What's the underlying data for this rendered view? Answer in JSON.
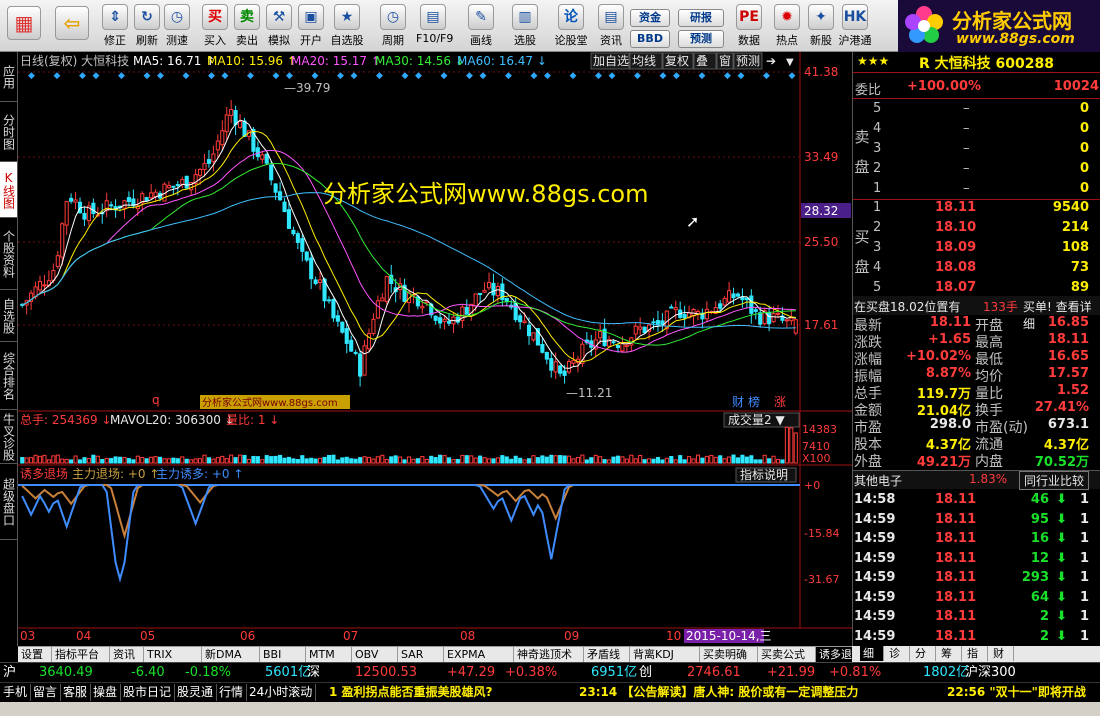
{
  "toolbar": {
    "items": [
      {
        "label": "",
        "icon": "windows-logo-icon"
      },
      {
        "label": "",
        "icon": "back-arrow-icon"
      },
      {
        "label": "修正",
        "icon": "up-down-icon"
      },
      {
        "label": "刷新",
        "icon": "refresh-icon"
      },
      {
        "label": "测速",
        "icon": "clock-icon"
      },
      {
        "label": "买入",
        "icon": "buy-icon",
        "glyph": "买"
      },
      {
        "label": "卖出",
        "icon": "sell-icon",
        "glyph": "卖"
      },
      {
        "label": "模拟",
        "icon": "hammer-icon"
      },
      {
        "label": "开户",
        "icon": "lock-icon"
      },
      {
        "label": "自选股",
        "icon": "star-folder-icon"
      },
      {
        "label": "周期",
        "icon": "period-icon"
      },
      {
        "label": "F10/F9",
        "icon": "f10-icon"
      },
      {
        "label": "画线",
        "icon": "pencil-icon"
      },
      {
        "label": "选股",
        "icon": "screen-select-icon"
      },
      {
        "label": "论股堂",
        "icon": "forum-icon",
        "glyph": "论"
      },
      {
        "label": "资讯",
        "icon": "news-icon"
      },
      {
        "label": "数据",
        "icon": "pe-icon",
        "glyph": "PE"
      },
      {
        "label": "热点",
        "icon": "hot-icon"
      },
      {
        "label": "新股",
        "icon": "new-stock-icon"
      },
      {
        "label": "沪港通",
        "icon": "hk-connect-icon"
      }
    ],
    "small_buttons": [
      "资金",
      "研报",
      "BBD",
      "预测"
    ]
  },
  "brand": {
    "title": "分析家公式网",
    "url": "www.88gs.com"
  },
  "leftnav": [
    "应用",
    "分时图",
    "K线图",
    "个股资料",
    "自选股",
    "综合排名",
    "牛叉诊股",
    "超级盘口"
  ],
  "chart_header": {
    "mode": "日线(复权)",
    "stock": "大恒科技",
    "ma": [
      {
        "label": "MA5: 16.71",
        "color": "#ffffff"
      },
      {
        "label": "MA10: 15.96",
        "color": "#ffee00"
      },
      {
        "label": "MA20: 15.17",
        "color": "#ff55ff"
      },
      {
        "label": "MA30: 14.56",
        "color": "#33ee33"
      },
      {
        "label": "MA60: 16.47",
        "color": "#3fbfff"
      }
    ],
    "buttons": [
      "加自选",
      "均线",
      "复权",
      "叠",
      "窗",
      "预测"
    ]
  },
  "price_axis": [
    "41.38",
    "33.49",
    "28.32",
    "25.50",
    "17.61"
  ],
  "price_annotations": {
    "high": "39.79",
    "low": "11.21"
  },
  "watermark": "分析家公式网www.88gs.com",
  "watermark_small": "分析家公式网www.88gs.com",
  "marker_q": "q",
  "badges": [
    "财",
    "榜",
    "涨"
  ],
  "volume": {
    "label": "总手: 254369",
    "mavol": "MAVOL20: 306300",
    "ratio": "量比: 1",
    "select": "成交量2",
    "axis": [
      "14383",
      "7410",
      "X100"
    ]
  },
  "indicator": {
    "title": "诱多退场",
    "l1": "主力退场: +0",
    "l2": "主力诱多: +0",
    "explain": "指标说明",
    "axis": [
      "+0",
      "-15.84",
      "-31.67"
    ]
  },
  "months": [
    "03",
    "04",
    "05",
    "06",
    "07",
    "08",
    "09",
    "10"
  ],
  "date_highlight": "2015-10-14,三",
  "bottom_tabs": [
    "设置",
    "指标平台",
    "资讯",
    "TRIX",
    "新DMA",
    "BBI",
    "MTM",
    "OBV",
    "SAR",
    "EXPMA",
    "神奇逃顶术",
    "矛盾线",
    "背离KDJ",
    "买卖明确",
    "买卖公式",
    "诱多退场"
  ],
  "right_tabs": [
    "细",
    "诊",
    "分",
    "筹",
    "指",
    "财"
  ],
  "quote": {
    "stock_line": "R 大恒科技 600288",
    "weibi_label": "委比",
    "weibi": "+100.00%",
    "weicha": "10024",
    "sell_label": "卖盘",
    "sell": [
      [
        "5",
        "–",
        "0"
      ],
      [
        "4",
        "–",
        "0"
      ],
      [
        "3",
        "–",
        "0"
      ],
      [
        "2",
        "–",
        "0"
      ],
      [
        "1",
        "–",
        "0"
      ]
    ],
    "buy_label": "买盘",
    "buy": [
      [
        "1",
        "18.11",
        "9540"
      ],
      [
        "2",
        "18.10",
        "214"
      ],
      [
        "3",
        "18.09",
        "108"
      ],
      [
        "4",
        "18.08",
        "73"
      ],
      [
        "5",
        "18.07",
        "89"
      ]
    ],
    "info_line": "在买盘18.02位置有",
    "info_hand": "133手",
    "info_tail": "买单! 查看详细",
    "stats": [
      [
        "最新",
        "18.11",
        "开盘",
        "16.85"
      ],
      [
        "涨跌",
        "+1.65",
        "最高",
        "18.11"
      ],
      [
        "涨幅",
        "+10.02%",
        "最低",
        "16.65"
      ],
      [
        "振幅",
        "8.87%",
        "均价",
        "17.57"
      ],
      [
        "总手",
        "119.7万",
        "量比",
        "1.52"
      ],
      [
        "金额",
        "21.04亿",
        "换手",
        "27.41%"
      ],
      [
        "市盈",
        "298.0",
        "市盈(动)",
        "673.1"
      ],
      [
        "股本",
        "4.37亿",
        "流通",
        "4.37亿"
      ],
      [
        "外盘",
        "49.21万",
        "内盘",
        "70.52万"
      ]
    ],
    "sector": "其他电子",
    "sector_pct": "1.83%",
    "sector_btn": "同行业比较",
    "ticks": [
      [
        "14:58",
        "18.11",
        "46",
        "1"
      ],
      [
        "14:59",
        "18.11",
        "95",
        "1"
      ],
      [
        "14:59",
        "18.11",
        "16",
        "1"
      ],
      [
        "14:59",
        "18.11",
        "12",
        "1"
      ],
      [
        "14:59",
        "18.11",
        "293",
        "1"
      ],
      [
        "14:59",
        "18.11",
        "64",
        "1"
      ],
      [
        "14:59",
        "18.11",
        "2",
        "1"
      ],
      [
        "14:59",
        "18.11",
        "2",
        "1"
      ]
    ]
  },
  "ticker": {
    "sh_label": "沪",
    "sh": "3640.49",
    "sh_chg": "-6.40",
    "sh_pct": "-0.18%",
    "sh_amt": "5601亿",
    "sz_label": "深",
    "sz": "12500.53",
    "sz_chg": "+47.29",
    "sz_pct": "+0.38%",
    "sz_amt": "6951亿",
    "cy_label": "创",
    "cy": "2746.61",
    "cy_chg": "+21.99",
    "cy_pct": "+0.81%",
    "cy_amt": "1802亿",
    "tail": "沪深300"
  },
  "statusbar": {
    "buttons": [
      "手机",
      "留言",
      "客服",
      "操盘",
      "股市日记",
      "股灵通",
      "行情",
      "24小时滚动"
    ],
    "news1": "1 盈利拐点能否重振美股雄风?",
    "news2": "23:14 【公告解读】唐人神: 股价或有一定调整压力",
    "news3": "22:56 \"双十一\"即将开战"
  },
  "colors": {
    "up": "#ff3b3b",
    "down": "#2fe7ff",
    "ma5": "#ffffff",
    "ma10": "#ffee00",
    "ma20": "#ff55ff",
    "ma30": "#33ee33",
    "ma60": "#3fbfff"
  }
}
